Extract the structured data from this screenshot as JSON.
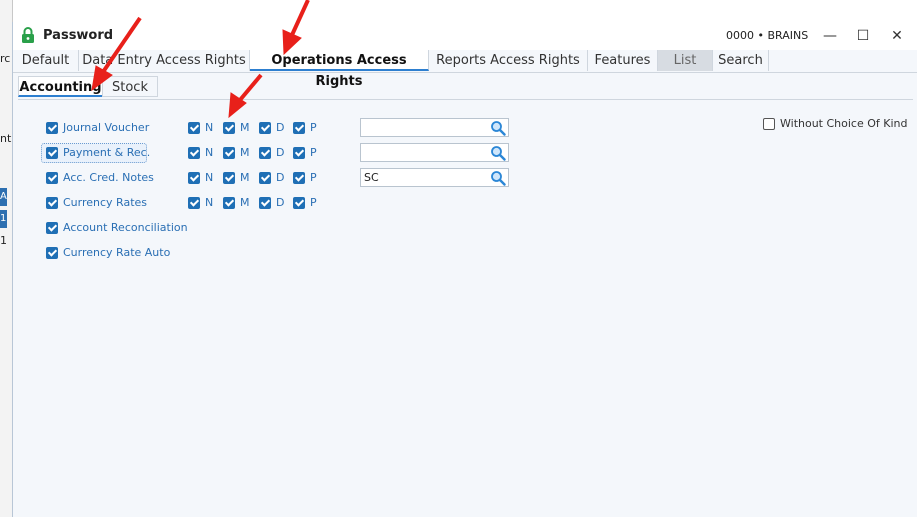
{
  "window": {
    "title": "Password",
    "company": "0000 • BRAINS",
    "minimize": "—",
    "maximize": "☐",
    "close": "✕"
  },
  "background": {
    "cut_text_1": "rc",
    "cut_text_2": "nt",
    "cut_text_3": "1",
    "cut_text_4": "1",
    "cut_text_5": "A"
  },
  "tabs": [
    {
      "label": "Default"
    },
    {
      "label": "Data Entry Access Rights"
    },
    {
      "label": "Operations Access Rights",
      "active": true
    },
    {
      "label": "Reports Access Rights"
    },
    {
      "label": "Features"
    },
    {
      "label": "List"
    },
    {
      "label": "Search"
    }
  ],
  "subtabs": [
    {
      "label": "Accounting",
      "active": true
    },
    {
      "label": "Stock"
    }
  ],
  "options": [
    {
      "label": "Journal Voucher",
      "checked": true
    },
    {
      "label": "Payment & Rec.",
      "checked": true,
      "focused": true
    },
    {
      "label": "Acc. Cred. Notes",
      "checked": true
    },
    {
      "label": "Currency Rates",
      "checked": true
    },
    {
      "label": "Account Reconciliation",
      "checked": true
    },
    {
      "label": "Currency Rate Auto",
      "checked": true
    }
  ],
  "flags": {
    "n": "N",
    "m": "M",
    "d": "D",
    "p": "P"
  },
  "lookups": [
    "",
    "",
    "SC"
  ],
  "without_choice": {
    "label": "Without Choice Of Kind",
    "checked": false
  },
  "colors": {
    "accent": "#1f6fb5",
    "label": "#2a6fb4",
    "annotation": "#e8201a"
  }
}
